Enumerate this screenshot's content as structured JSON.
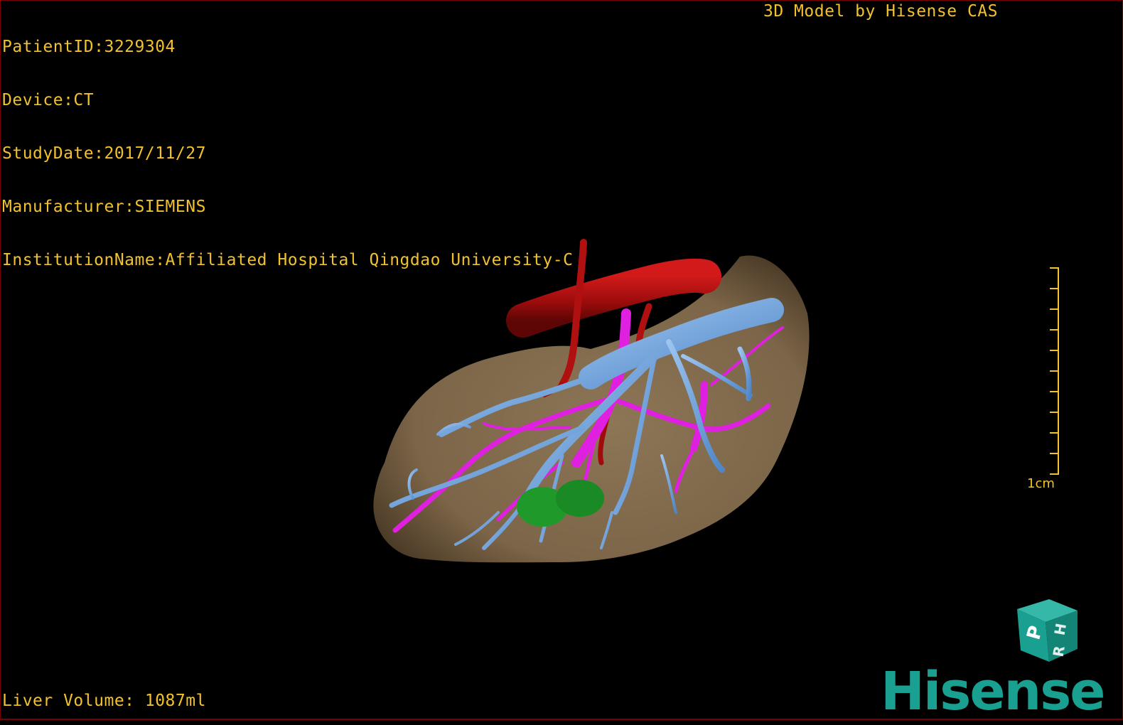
{
  "overlay": {
    "patient_id": "PatientID:3229304",
    "device": "Device:CT",
    "study_date": "StudyDate:2017/11/27",
    "manufacturer": "Manufacturer:SIEMENS",
    "institution": "InstitutionName:Affiliated Hospital Qingdao University-C",
    "credit": "3D Model by Hisense CAS",
    "liver_volume": "Liver Volume: 1087ml"
  },
  "scale": {
    "label": "1cm",
    "ticks": 10
  },
  "orientation_cube": {
    "faces": [
      "P",
      "H",
      "R"
    ],
    "color": "#1aa091"
  },
  "brand": {
    "name": "Hisense",
    "color": "#1aa091"
  },
  "colors": {
    "text": "#f2c12e",
    "liver": "#8b7352",
    "portal_vein": "#6a9fd8",
    "hepatic_vein": "#e020e0",
    "artery": "#b01010",
    "lesion": "#1f9a2a"
  }
}
